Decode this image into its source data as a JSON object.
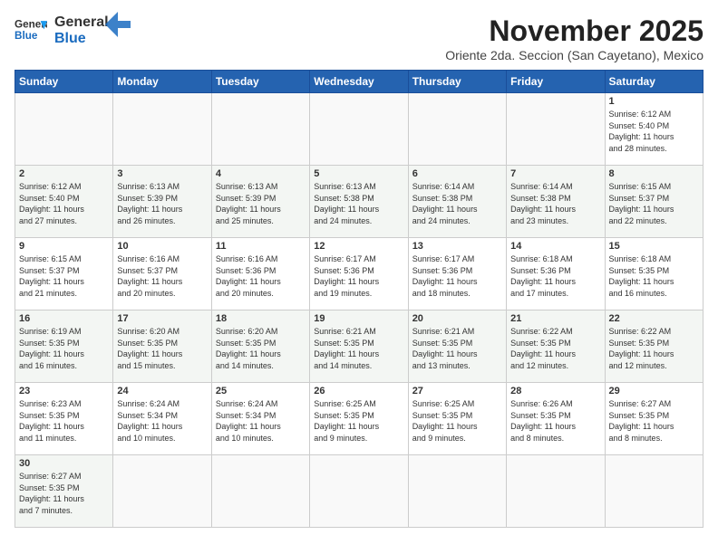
{
  "header": {
    "logo_general": "General",
    "logo_blue": "Blue",
    "month_title": "November 2025",
    "subtitle": "Oriente 2da. Seccion (San Cayetano), Mexico"
  },
  "days_of_week": [
    "Sunday",
    "Monday",
    "Tuesday",
    "Wednesday",
    "Thursday",
    "Friday",
    "Saturday"
  ],
  "weeks": [
    [
      {
        "day": "",
        "info": ""
      },
      {
        "day": "",
        "info": ""
      },
      {
        "day": "",
        "info": ""
      },
      {
        "day": "",
        "info": ""
      },
      {
        "day": "",
        "info": ""
      },
      {
        "day": "",
        "info": ""
      },
      {
        "day": "1",
        "info": "Sunrise: 6:12 AM\nSunset: 5:40 PM\nDaylight: 11 hours\nand 28 minutes."
      }
    ],
    [
      {
        "day": "2",
        "info": "Sunrise: 6:12 AM\nSunset: 5:40 PM\nDaylight: 11 hours\nand 27 minutes."
      },
      {
        "day": "3",
        "info": "Sunrise: 6:13 AM\nSunset: 5:39 PM\nDaylight: 11 hours\nand 26 minutes."
      },
      {
        "day": "4",
        "info": "Sunrise: 6:13 AM\nSunset: 5:39 PM\nDaylight: 11 hours\nand 25 minutes."
      },
      {
        "day": "5",
        "info": "Sunrise: 6:13 AM\nSunset: 5:38 PM\nDaylight: 11 hours\nand 24 minutes."
      },
      {
        "day": "6",
        "info": "Sunrise: 6:14 AM\nSunset: 5:38 PM\nDaylight: 11 hours\nand 24 minutes."
      },
      {
        "day": "7",
        "info": "Sunrise: 6:14 AM\nSunset: 5:38 PM\nDaylight: 11 hours\nand 23 minutes."
      },
      {
        "day": "8",
        "info": "Sunrise: 6:15 AM\nSunset: 5:37 PM\nDaylight: 11 hours\nand 22 minutes."
      }
    ],
    [
      {
        "day": "9",
        "info": "Sunrise: 6:15 AM\nSunset: 5:37 PM\nDaylight: 11 hours\nand 21 minutes."
      },
      {
        "day": "10",
        "info": "Sunrise: 6:16 AM\nSunset: 5:37 PM\nDaylight: 11 hours\nand 20 minutes."
      },
      {
        "day": "11",
        "info": "Sunrise: 6:16 AM\nSunset: 5:36 PM\nDaylight: 11 hours\nand 20 minutes."
      },
      {
        "day": "12",
        "info": "Sunrise: 6:17 AM\nSunset: 5:36 PM\nDaylight: 11 hours\nand 19 minutes."
      },
      {
        "day": "13",
        "info": "Sunrise: 6:17 AM\nSunset: 5:36 PM\nDaylight: 11 hours\nand 18 minutes."
      },
      {
        "day": "14",
        "info": "Sunrise: 6:18 AM\nSunset: 5:36 PM\nDaylight: 11 hours\nand 17 minutes."
      },
      {
        "day": "15",
        "info": "Sunrise: 6:18 AM\nSunset: 5:35 PM\nDaylight: 11 hours\nand 16 minutes."
      }
    ],
    [
      {
        "day": "16",
        "info": "Sunrise: 6:19 AM\nSunset: 5:35 PM\nDaylight: 11 hours\nand 16 minutes."
      },
      {
        "day": "17",
        "info": "Sunrise: 6:20 AM\nSunset: 5:35 PM\nDaylight: 11 hours\nand 15 minutes."
      },
      {
        "day": "18",
        "info": "Sunrise: 6:20 AM\nSunset: 5:35 PM\nDaylight: 11 hours\nand 14 minutes."
      },
      {
        "day": "19",
        "info": "Sunrise: 6:21 AM\nSunset: 5:35 PM\nDaylight: 11 hours\nand 14 minutes."
      },
      {
        "day": "20",
        "info": "Sunrise: 6:21 AM\nSunset: 5:35 PM\nDaylight: 11 hours\nand 13 minutes."
      },
      {
        "day": "21",
        "info": "Sunrise: 6:22 AM\nSunset: 5:35 PM\nDaylight: 11 hours\nand 12 minutes."
      },
      {
        "day": "22",
        "info": "Sunrise: 6:22 AM\nSunset: 5:35 PM\nDaylight: 11 hours\nand 12 minutes."
      }
    ],
    [
      {
        "day": "23",
        "info": "Sunrise: 6:23 AM\nSunset: 5:35 PM\nDaylight: 11 hours\nand 11 minutes."
      },
      {
        "day": "24",
        "info": "Sunrise: 6:24 AM\nSunset: 5:34 PM\nDaylight: 11 hours\nand 10 minutes."
      },
      {
        "day": "25",
        "info": "Sunrise: 6:24 AM\nSunset: 5:34 PM\nDaylight: 11 hours\nand 10 minutes."
      },
      {
        "day": "26",
        "info": "Sunrise: 6:25 AM\nSunset: 5:35 PM\nDaylight: 11 hours\nand 9 minutes."
      },
      {
        "day": "27",
        "info": "Sunrise: 6:25 AM\nSunset: 5:35 PM\nDaylight: 11 hours\nand 9 minutes."
      },
      {
        "day": "28",
        "info": "Sunrise: 6:26 AM\nSunset: 5:35 PM\nDaylight: 11 hours\nand 8 minutes."
      },
      {
        "day": "29",
        "info": "Sunrise: 6:27 AM\nSunset: 5:35 PM\nDaylight: 11 hours\nand 8 minutes."
      }
    ],
    [
      {
        "day": "30",
        "info": "Sunrise: 6:27 AM\nSunset: 5:35 PM\nDaylight: 11 hours\nand 7 minutes."
      },
      {
        "day": "",
        "info": ""
      },
      {
        "day": "",
        "info": ""
      },
      {
        "day": "",
        "info": ""
      },
      {
        "day": "",
        "info": ""
      },
      {
        "day": "",
        "info": ""
      },
      {
        "day": "",
        "info": ""
      }
    ]
  ]
}
